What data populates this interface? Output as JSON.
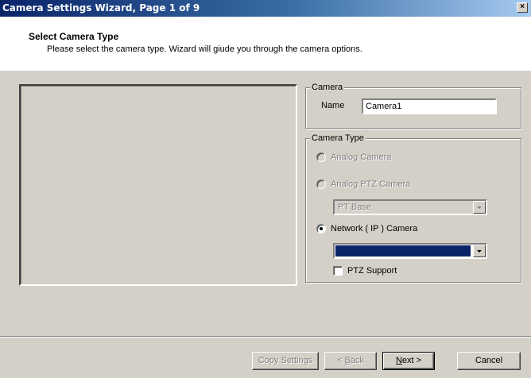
{
  "window": {
    "title": "Camera Settings Wizard, Page 1 of 9",
    "close_glyph": "×"
  },
  "header": {
    "title": "Select Camera Type",
    "subtitle": "Please select the  camera type. Wizard will giude you through the camera options."
  },
  "camera_group": {
    "legend": "Camera",
    "name_label": "Name",
    "name_value": "Camera1"
  },
  "camera_type_group": {
    "legend": "Camera Type",
    "analog": {
      "label": "Analog Camera",
      "checked": false,
      "enabled": false
    },
    "analog_ptz": {
      "label": "Analog PTZ Camera",
      "checked": false,
      "enabled": false
    },
    "ptz_base_select": {
      "value": "PT Base",
      "enabled": false
    },
    "network": {
      "label": "Network ( IP ) Camera",
      "checked": true,
      "enabled": true
    },
    "network_select": {
      "value": "",
      "enabled": true
    },
    "ptz_support": {
      "label": "PTZ Support",
      "checked": false
    }
  },
  "buttons": {
    "copy_settings": "Copy Settings",
    "back_prefix": "< ",
    "back_accel": "B",
    "back_rest": "ack",
    "next_accel": "N",
    "next_rest": "ext >",
    "cancel": "Cancel"
  },
  "colors": {
    "face": "#d4d0c8",
    "title_start": "#0a246a",
    "title_end": "#a6caf0",
    "selection": "#0a246a"
  }
}
